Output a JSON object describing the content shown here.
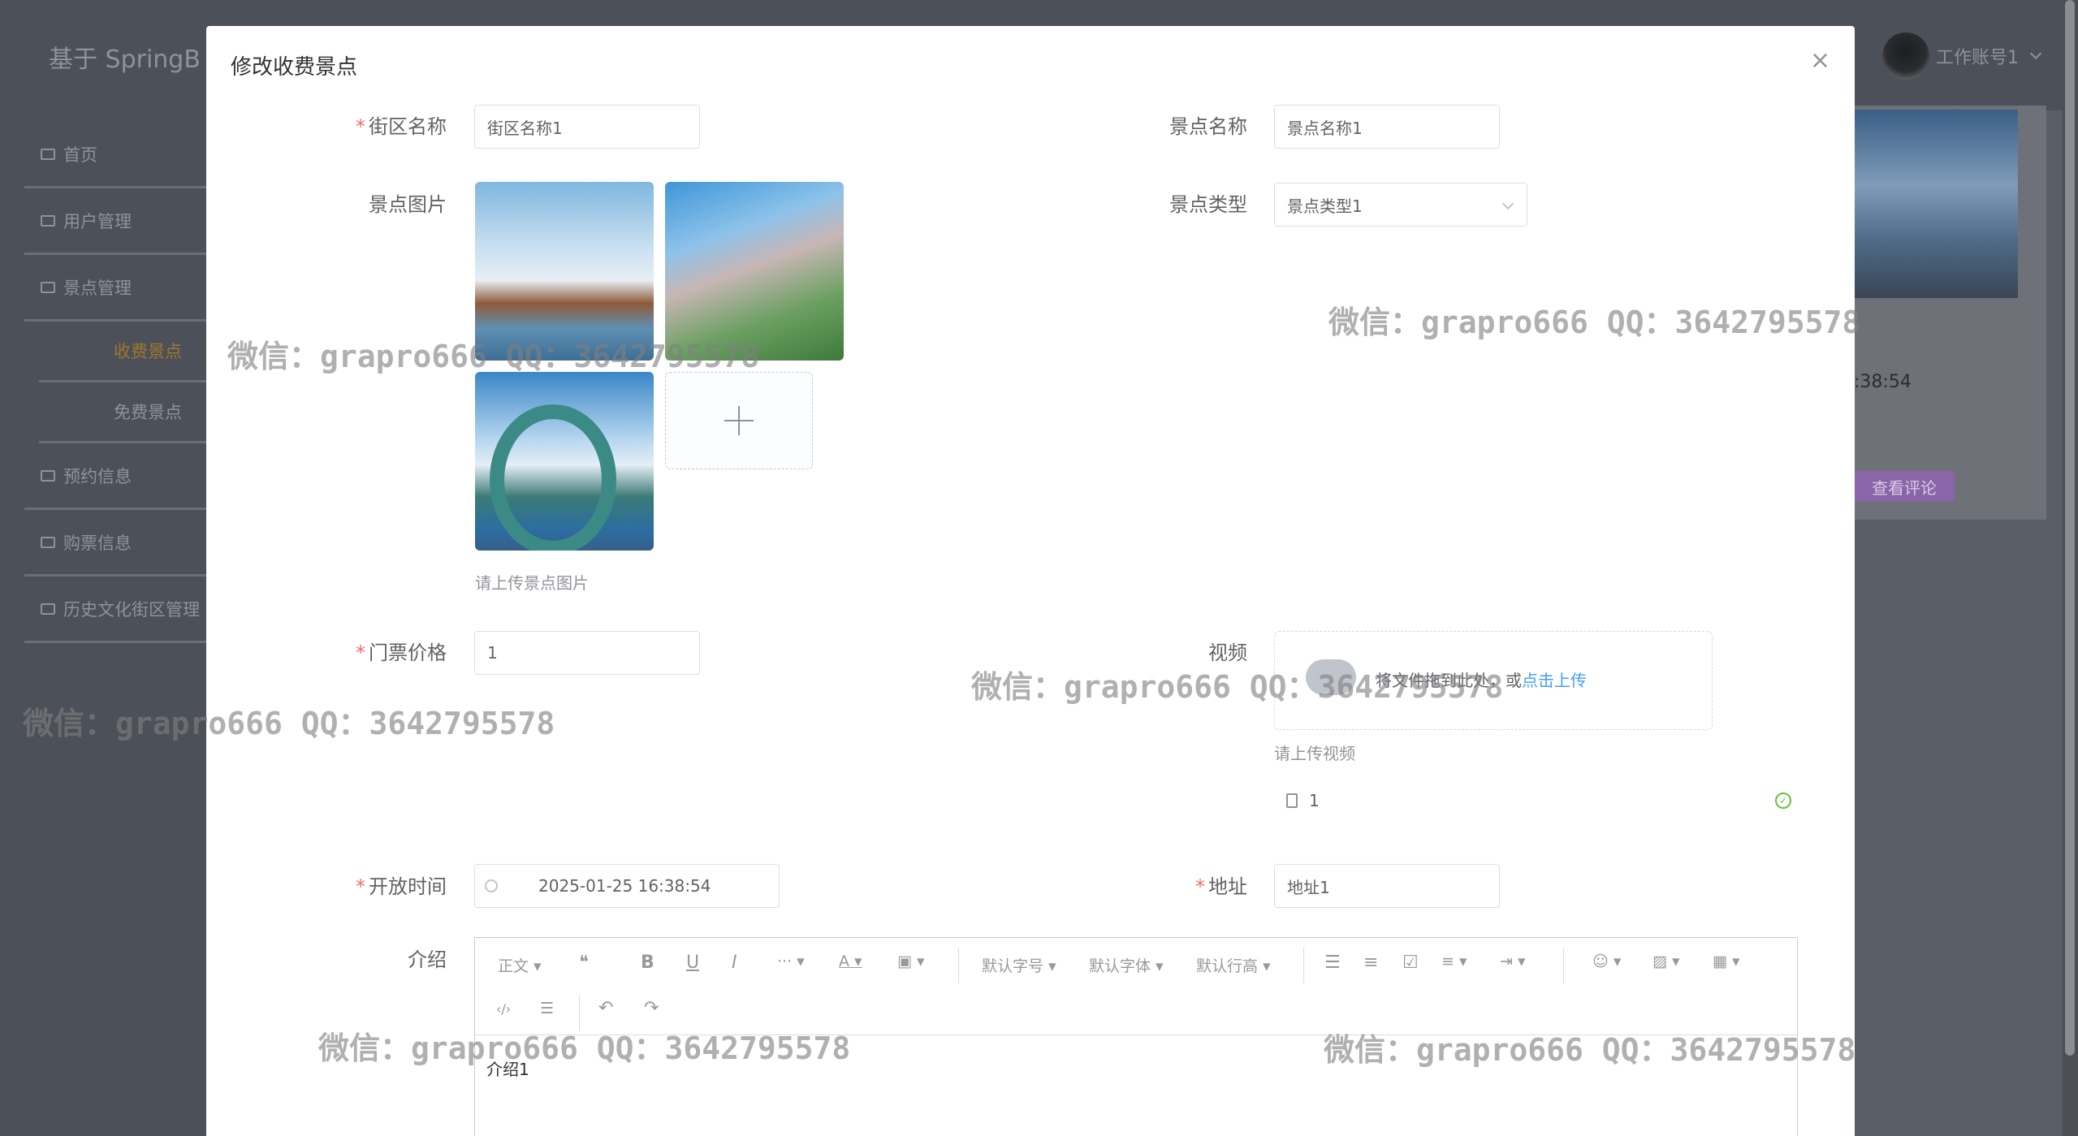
{
  "header": {
    "brand": "基于 SpringB",
    "user_name": "工作账号1"
  },
  "sidebar": {
    "items": [
      {
        "label": "首页",
        "icon": "home-icon"
      },
      {
        "label": "用户管理",
        "icon": "user-icon"
      },
      {
        "label": "景点管理",
        "icon": "scenic-icon"
      },
      {
        "label": "收费景点",
        "sub": true,
        "active": true
      },
      {
        "label": "免费景点",
        "sub": true
      },
      {
        "label": "预约信息",
        "icon": "booking-icon"
      },
      {
        "label": "购票信息",
        "icon": "ticket-icon"
      },
      {
        "label": "历史文化街区管理",
        "icon": "culture-icon"
      }
    ]
  },
  "background_content": {
    "time_fragment": ":38:54",
    "review_button": "查看评论"
  },
  "dialog": {
    "title": "修改收费景点",
    "close": "×",
    "form": {
      "district": {
        "label": "街区名称",
        "required": true,
        "value": "街区名称1"
      },
      "scenic_name": {
        "label": "景点名称",
        "required": false,
        "value": "景点名称1"
      },
      "scenic_images": {
        "label": "景点图片",
        "tip": "请上传景点图片",
        "count": 3
      },
      "scenic_type": {
        "label": "景点类型",
        "value": "景点类型1"
      },
      "price": {
        "label": "门票价格",
        "required": true,
        "value": "1"
      },
      "video": {
        "label": "视频",
        "drop_text": "将文件拖到此处，或",
        "drop_link": "点击上传",
        "tip": "请上传视频",
        "file_name": "1"
      },
      "open_time": {
        "label": "开放时间",
        "required": true,
        "value": "2025-01-25 16:38:54"
      },
      "address": {
        "label": "地址",
        "required": true,
        "value": "地址1"
      },
      "intro": {
        "label": "介绍",
        "toolbar": [
          "正文",
          "默认字号",
          "默认字体",
          "默认行高"
        ],
        "content": "介绍1"
      }
    }
  },
  "watermark": "微信：grapro666 QQ：3642795578"
}
